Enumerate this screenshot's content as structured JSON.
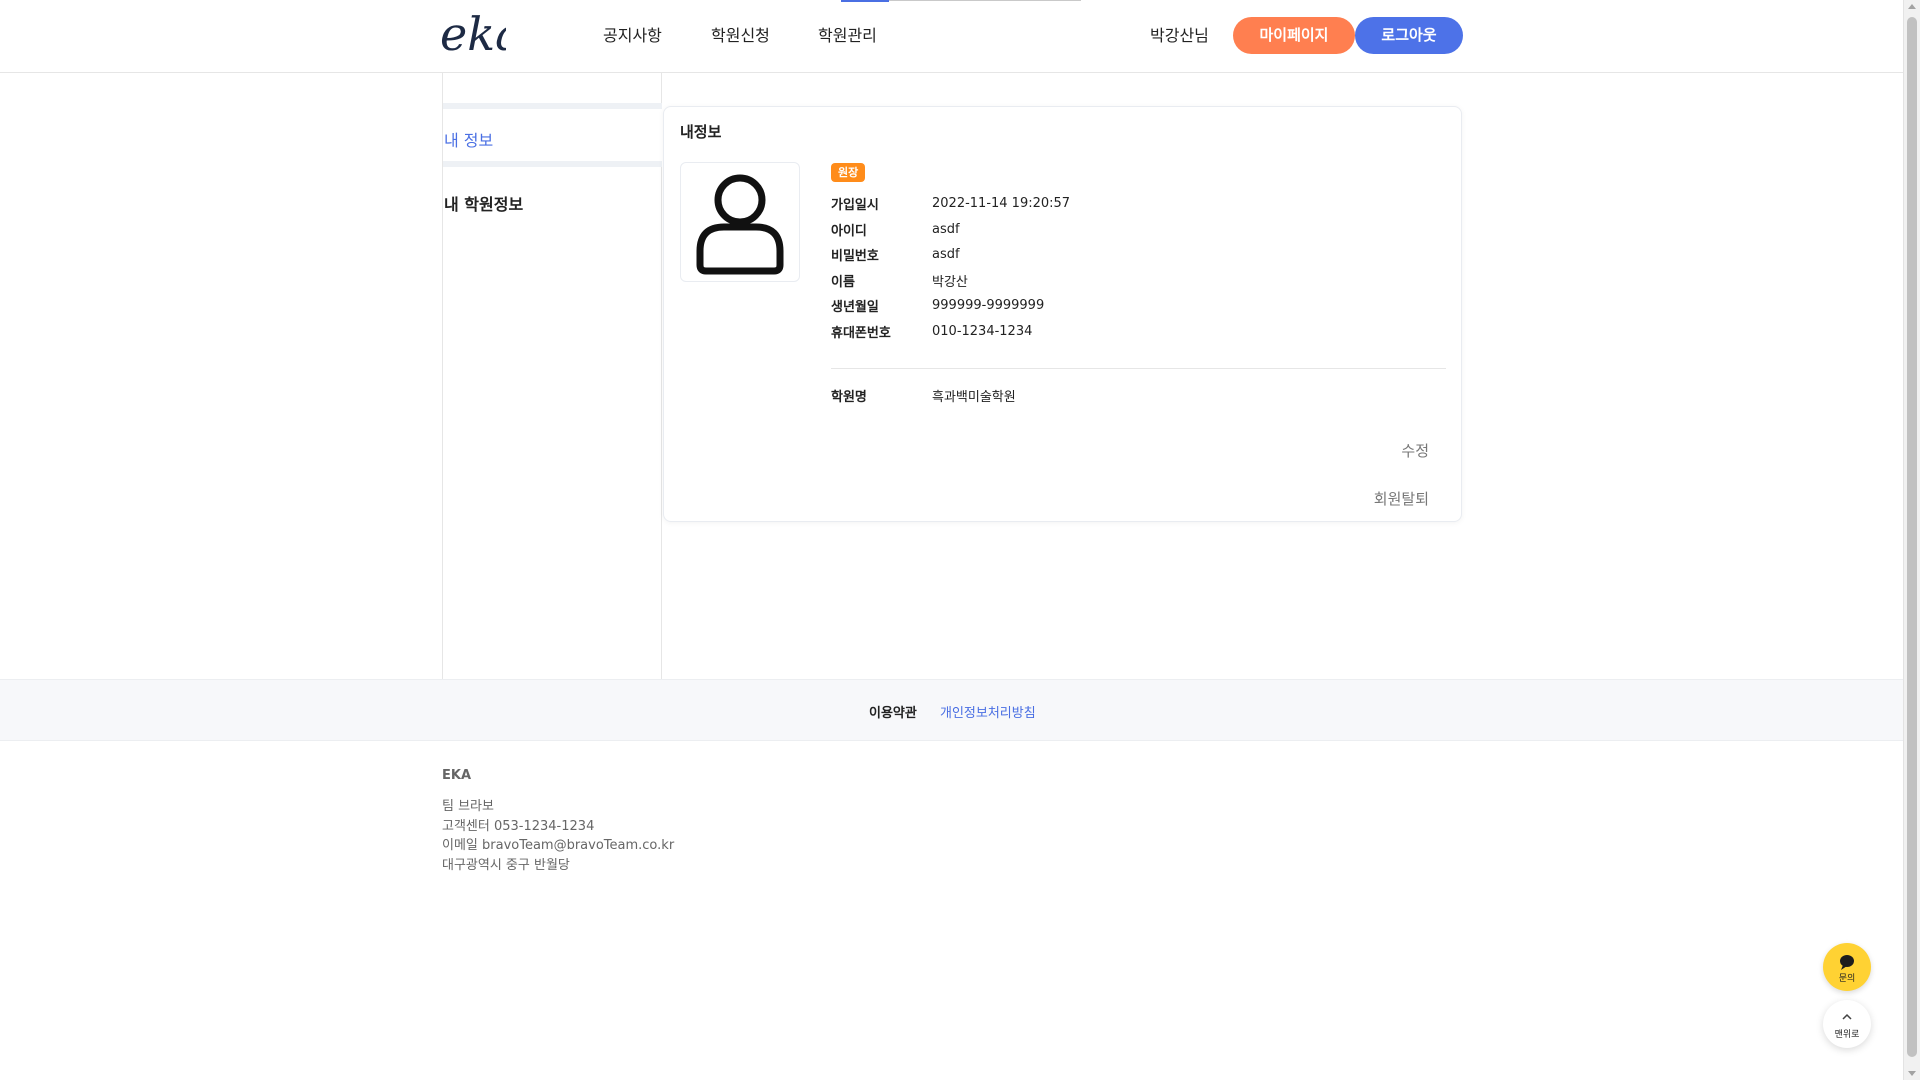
{
  "header": {
    "logo_text": "eka",
    "nav": [
      {
        "label": "공지사항"
      },
      {
        "label": "학원신청"
      },
      {
        "label": "학원관리"
      }
    ],
    "user_name": "박강산님",
    "mypage_label": "마이페이지",
    "logout_label": "로그아웃"
  },
  "sidebar": {
    "items": [
      {
        "label": "내 정보",
        "active": true
      },
      {
        "label": "내 학원정보",
        "active": false
      }
    ]
  },
  "profile": {
    "title": "내정보",
    "avatar_icon": "user-icon",
    "role_badge": "원장",
    "fields": [
      {
        "label": "가입일시",
        "value": "2022-11-14 19:20:57"
      },
      {
        "label": "아이디",
        "value": "asdf"
      },
      {
        "label": "비밀번호",
        "value": "asdf"
      },
      {
        "label": "이름",
        "value": "박강산"
      },
      {
        "label": "생년월일",
        "value": "999999-9999999"
      },
      {
        "label": "휴대폰번호",
        "value": "010-1234-1234"
      }
    ],
    "academy": {
      "label": "학원명",
      "value": "흑과백미술학원"
    },
    "edit_label": "수정",
    "withdraw_label": "회원탈퇴"
  },
  "footer": {
    "terms_label": "이용약관",
    "privacy_label": "개인정보처리방침",
    "brand": "EKA",
    "lines": [
      "팀 브라보",
      "고객센터 053-1234-1234",
      "이메일 bravoTeam@bravoTeam.co.kr",
      "대구광역시 중구 반월당"
    ]
  },
  "floating": {
    "inquiry_label": "문의",
    "inquiry_icon": "chat-bubble-icon",
    "top_label": "맨위로",
    "top_icon": "chevron-up-icon"
  },
  "colors": {
    "accent_blue": "#4d72e8",
    "accent_orange": "#ff7f50",
    "badge_orange": "#ff8c1a",
    "inquiry_yellow": "#ffd233"
  }
}
